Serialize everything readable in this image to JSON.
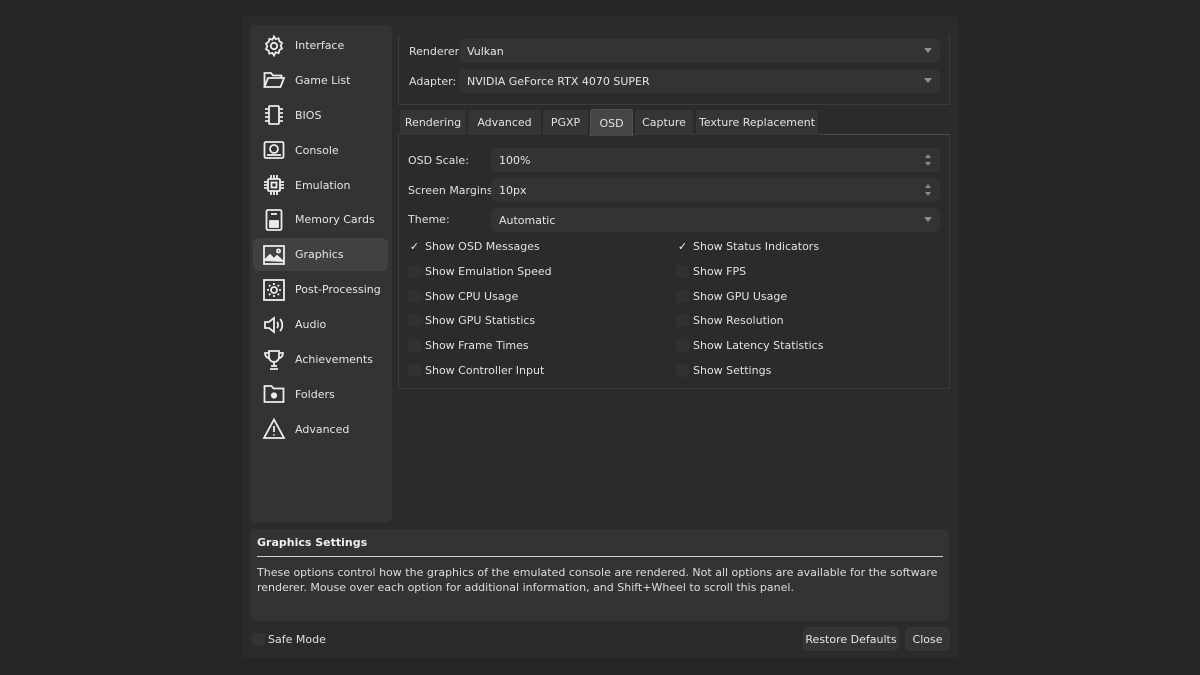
{
  "sidebar": {
    "items": [
      {
        "label": "Interface",
        "icon": "gear-icon"
      },
      {
        "label": "Game List",
        "icon": "folder-open-icon"
      },
      {
        "label": "BIOS",
        "icon": "chip-icon"
      },
      {
        "label": "Console",
        "icon": "console-icon"
      },
      {
        "label": "Emulation",
        "icon": "cpu-icon"
      },
      {
        "label": "Memory Cards",
        "icon": "memory-card-icon"
      },
      {
        "label": "Graphics",
        "icon": "image-icon"
      },
      {
        "label": "Post-Processing",
        "icon": "sun-icon"
      },
      {
        "label": "Audio",
        "icon": "speaker-icon"
      },
      {
        "label": "Achievements",
        "icon": "trophy-icon"
      },
      {
        "label": "Folders",
        "icon": "folder-settings-icon"
      },
      {
        "label": "Advanced",
        "icon": "warning-icon"
      }
    ],
    "active": "Graphics"
  },
  "top": {
    "renderer_label": "Renderer:",
    "renderer_value": "Vulkan",
    "adapter_label": "Adapter:",
    "adapter_value": "NVIDIA GeForce RTX 4070 SUPER"
  },
  "tabs": [
    "Rendering",
    "Advanced",
    "PGXP",
    "OSD",
    "Capture",
    "Texture Replacement"
  ],
  "active_tab": "OSD",
  "osd": {
    "scale_label": "OSD Scale:",
    "scale_value": "100%",
    "margins_label": "Screen Margins:",
    "margins_value": "10px",
    "theme_label": "Theme:",
    "theme_value": "Automatic",
    "left_checks": [
      {
        "label": "Show OSD Messages",
        "checked": true
      },
      {
        "label": "Show Emulation Speed",
        "checked": false
      },
      {
        "label": "Show CPU Usage",
        "checked": false
      },
      {
        "label": "Show GPU Statistics",
        "checked": false
      },
      {
        "label": "Show Frame Times",
        "checked": false
      },
      {
        "label": "Show Controller Input",
        "checked": false
      }
    ],
    "right_checks": [
      {
        "label": "Show Status Indicators",
        "checked": true
      },
      {
        "label": "Show FPS",
        "checked": false
      },
      {
        "label": "Show GPU Usage",
        "checked": false
      },
      {
        "label": "Show Resolution",
        "checked": false
      },
      {
        "label": "Show Latency Statistics",
        "checked": false
      },
      {
        "label": "Show Settings",
        "checked": false
      }
    ]
  },
  "info": {
    "title": "Graphics Settings",
    "text": "These options control how the graphics of the emulated console are rendered. Not all options are available for the software renderer. Mouse over each option for additional information, and Shift+Wheel to scroll this panel."
  },
  "footer": {
    "safe_mode_label": "Safe Mode",
    "safe_mode_checked": false,
    "restore_label": "Restore Defaults",
    "close_label": "Close"
  },
  "colors": {
    "window_bg": "#2b2b2b",
    "panel_bg": "#333333",
    "active_item": "#414141"
  }
}
